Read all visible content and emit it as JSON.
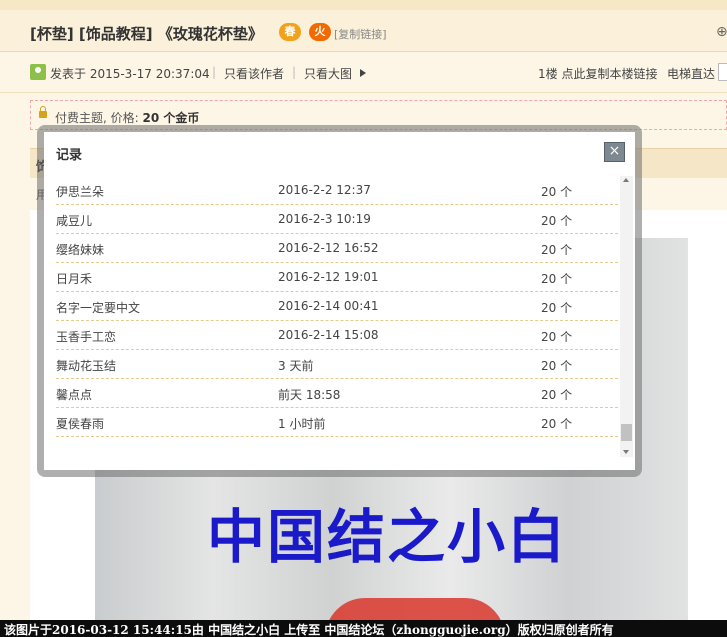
{
  "thread": {
    "title": "[杯垫] [饰品教程] 《玫瑰花杯垫》",
    "badge_spring": "春",
    "badge_fire": "火",
    "copy_link": "[复制链接]"
  },
  "meta": {
    "posted_at": "发表于 2015-3-17 20:37:04",
    "only_author": "只看该作者",
    "only_images": "只看大图",
    "floor": "1楼 点此复制本楼链接",
    "elevator": "电梯直达"
  },
  "paid": {
    "label": "付费主题, 价格:",
    "price": "20 个金币"
  },
  "section": {
    "head": "饰",
    "sub": "用"
  },
  "photo": {
    "caption": "中国结之小白"
  },
  "modal": {
    "title": "记录",
    "close": "×",
    "records": [
      {
        "name": "伊思兰朵",
        "time": "2016-2-2 12:37",
        "amount": "20 个"
      },
      {
        "name": "咸豆儿",
        "time": "2016-2-3 10:19",
        "amount": "20 个"
      },
      {
        "name": "缨络妹妹",
        "time": "2016-2-12 16:52",
        "amount": "20 个"
      },
      {
        "name": "日月禾",
        "time": "2016-2-12 19:01",
        "amount": "20 个"
      },
      {
        "name": "名字一定要中文",
        "time": "2016-2-14 00:41",
        "amount": "20 个"
      },
      {
        "name": "玉香手工恋",
        "time": "2016-2-14 15:08",
        "amount": "20 个"
      },
      {
        "name": "舞动花玉结",
        "time": "3 天前",
        "amount": "20 个"
      },
      {
        "name": "馨点点",
        "time": "前天 18:58",
        "amount": "20 个"
      },
      {
        "name": "夏侯春雨",
        "time": "1 小时前",
        "amount": "20 个"
      }
    ]
  },
  "footer": {
    "watermark": "该图片于2016-03-12 15:44:15由 中国结之小白 上传至 中国结论坛（zhongguojie.org）版权归原创者所有"
  }
}
